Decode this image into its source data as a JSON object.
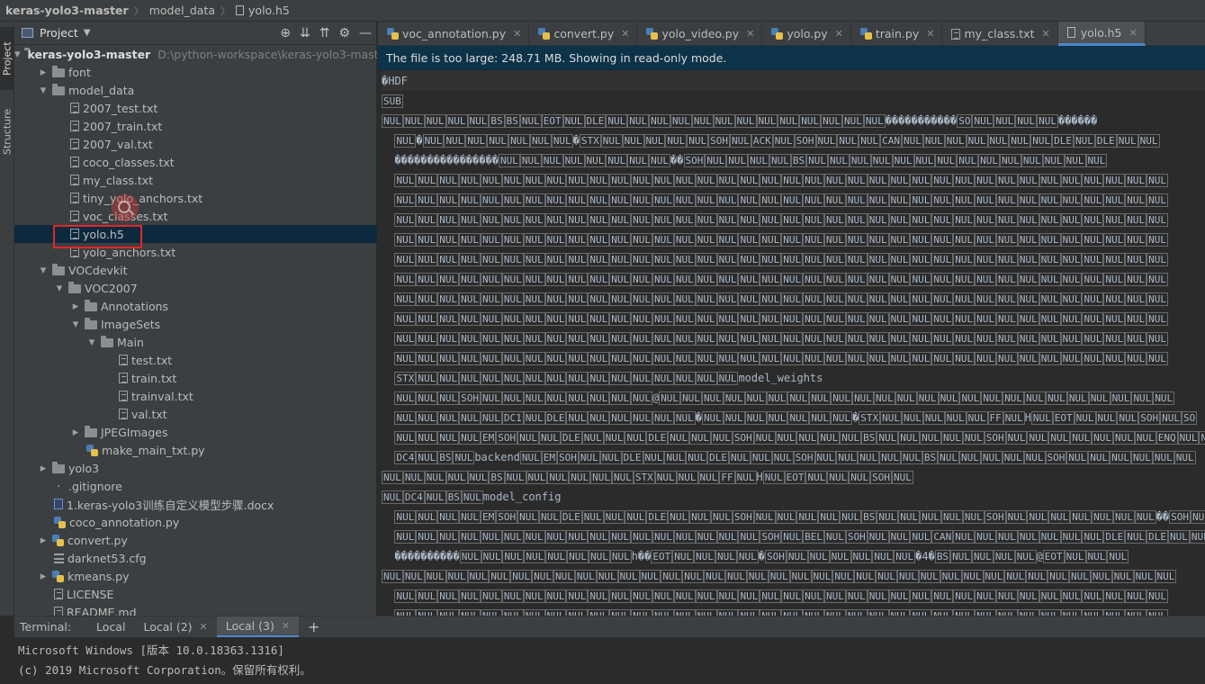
{
  "breadcrumb": [
    "keras-yolo3-master",
    "model_data",
    "yolo.h5"
  ],
  "side_strip": {
    "project": "Project",
    "structure": "Structure"
  },
  "project_panel": {
    "title": "Project"
  },
  "tree": [
    {
      "label": "keras-yolo3-master",
      "path": "D:\\python-workspace\\keras-yolo3-master",
      "type": "folder",
      "depth": 0,
      "expanded": true,
      "bold": true
    },
    {
      "label": "font",
      "type": "folder",
      "depth": 1,
      "expanded": false
    },
    {
      "label": "model_data",
      "type": "folder",
      "depth": 1,
      "expanded": true
    },
    {
      "label": "2007_test.txt",
      "type": "txt",
      "depth": 2
    },
    {
      "label": "2007_train.txt",
      "type": "txt",
      "depth": 2
    },
    {
      "label": "2007_val.txt",
      "type": "txt",
      "depth": 2
    },
    {
      "label": "coco_classes.txt",
      "type": "txt",
      "depth": 2
    },
    {
      "label": "my_class.txt",
      "type": "txt",
      "depth": 2
    },
    {
      "label": "tiny_yolo_anchors.txt",
      "type": "txt",
      "depth": 2
    },
    {
      "label": "voc_classes.txt",
      "type": "txt",
      "depth": 2
    },
    {
      "label": "yolo.h5",
      "type": "txt",
      "depth": 2,
      "selected": true
    },
    {
      "label": "yolo_anchors.txt",
      "type": "txt",
      "depth": 2
    },
    {
      "label": "VOCdevkit",
      "type": "folder",
      "depth": 1,
      "expanded": true
    },
    {
      "label": "VOC2007",
      "type": "folder",
      "depth": 2,
      "expanded": true
    },
    {
      "label": "Annotations",
      "type": "folder",
      "depth": 3,
      "expanded": false
    },
    {
      "label": "ImageSets",
      "type": "folder",
      "depth": 3,
      "expanded": true
    },
    {
      "label": "Main",
      "type": "folder",
      "depth": 4,
      "expanded": true
    },
    {
      "label": "test.txt",
      "type": "txt",
      "depth": 5
    },
    {
      "label": "train.txt",
      "type": "txt",
      "depth": 5
    },
    {
      "label": "trainval.txt",
      "type": "txt",
      "depth": 5
    },
    {
      "label": "val.txt",
      "type": "txt",
      "depth": 5
    },
    {
      "label": "JPEGImages",
      "type": "folder",
      "depth": 3,
      "expanded": false
    },
    {
      "label": "make_main_txt.py",
      "type": "py",
      "depth": 3
    },
    {
      "label": "yolo3",
      "type": "folder",
      "depth": 1,
      "expanded": false
    },
    {
      "label": ".gitignore",
      "type": "git",
      "depth": 1
    },
    {
      "label": "1.keras-yolo3训练自定义模型步骤.docx",
      "type": "doc",
      "depth": 1
    },
    {
      "label": "coco_annotation.py",
      "type": "py",
      "depth": 1
    },
    {
      "label": "convert.py",
      "type": "py",
      "depth": 1,
      "expanded": false,
      "arrow": true
    },
    {
      "label": "darknet53.cfg",
      "type": "cfg",
      "depth": 1
    },
    {
      "label": "kmeans.py",
      "type": "py",
      "depth": 1,
      "expanded": false,
      "arrow": true
    },
    {
      "label": "LICENSE",
      "type": "txt",
      "depth": 1
    },
    {
      "label": "README.md",
      "type": "txt",
      "depth": 1
    }
  ],
  "tabs": [
    {
      "label": "voc_annotation.py",
      "type": "py"
    },
    {
      "label": "convert.py",
      "type": "py"
    },
    {
      "label": "yolo_video.py",
      "type": "py"
    },
    {
      "label": "yolo.py",
      "type": "py"
    },
    {
      "label": "train.py",
      "type": "py"
    },
    {
      "label": "my_class.txt",
      "type": "txt"
    },
    {
      "label": "yolo.h5",
      "type": "h5",
      "active": true
    }
  ],
  "info_bar": "The file is too large: 248.71 MB. Showing in read-only mode.",
  "editor_lines": [
    "�HDF",
    "[SUB]",
    "[NUL][NUL][NUL][NUL][NUL][BS][BS][NUL][EOT][NUL][DLE][NUL][NUL][NUL][NUL][NUL][NUL][NUL][NUL][NUL][NUL][NUL][NUL][NUL]�����������[SO][NUL][NUL][NUL][NUL]������",
    "  [NUL]�[NUL][NUL][NUL][NUL][NUL][NUL][NUL]�[STX][NUL][NUL][NUL][NUL][NUL][SOH][NUL][ACK][NUL][SOH][NUL][NUL][NUL][CAN][NUL][NUL][NUL][NUL][NUL][NUL][NUL][DLE][NUL][DLE][NUL][NUL]",
    "  ����������������[NUL][NUL][NUL][NUL][NUL][NUL][NUL][NUL]��[SOH][NUL][NUL][NUL][NUL][BS][NUL][NUL][NUL][NUL][NUL][NUL][NUL][NUL][NUL][NUL][NUL][NUL][NUL][NUL]",
    "  [NUL][NUL][NUL][NUL][NUL][NUL][NUL][NUL][NUL][NUL][NUL][NUL][NUL][NUL][NUL][NUL][NUL][NUL][NUL][NUL][NUL][NUL][NUL][NUL][NUL][NUL][NUL][NUL][NUL][NUL][NUL][NUL][NUL][NUL][NUL][NUL]",
    "  [NUL][NUL][NUL][NUL][NUL][NUL][NUL][NUL][NUL][NUL][NUL][NUL][NUL][NUL][NUL][NUL][NUL][NUL][NUL][NUL][NUL][NUL][NUL][NUL][NUL][NUL][NUL][NUL][NUL][NUL][NUL][NUL][NUL][NUL][NUL][NUL]",
    "  [NUL][NUL][NUL][NUL][NUL][NUL][NUL][NUL][NUL][NUL][NUL][NUL][NUL][NUL][NUL][NUL][NUL][NUL][NUL][NUL][NUL][NUL][NUL][NUL][NUL][NUL][NUL][NUL][NUL][NUL][NUL][NUL][NUL][NUL][NUL][NUL]",
    "  [NUL][NUL][NUL][NUL][NUL][NUL][NUL][NUL][NUL][NUL][NUL][NUL][NUL][NUL][NUL][NUL][NUL][NUL][NUL][NUL][NUL][NUL][NUL][NUL][NUL][NUL][NUL][NUL][NUL][NUL][NUL][NUL][NUL][NUL][NUL][NUL]",
    "  [NUL][NUL][NUL][NUL][NUL][NUL][NUL][NUL][NUL][NUL][NUL][NUL][NUL][NUL][NUL][NUL][NUL][NUL][NUL][NUL][NUL][NUL][NUL][NUL][NUL][NUL][NUL][NUL][NUL][NUL][NUL][NUL][NUL][NUL][NUL][NUL]",
    "  [NUL][NUL][NUL][NUL][NUL][NUL][NUL][NUL][NUL][NUL][NUL][NUL][NUL][NUL][NUL][NUL][NUL][NUL][NUL][NUL][NUL][NUL][NUL][NUL][NUL][NUL][NUL][NUL][NUL][NUL][NUL][NUL][NUL][NUL][NUL][NUL]",
    "  [NUL][NUL][NUL][NUL][NUL][NUL][NUL][NUL][NUL][NUL][NUL][NUL][NUL][NUL][NUL][NUL][NUL][NUL][NUL][NUL][NUL][NUL][NUL][NUL][NUL][NUL][NUL][NUL][NUL][NUL][NUL][NUL][NUL][NUL][NUL][NUL]",
    "  [NUL][NUL][NUL][NUL][NUL][NUL][NUL][NUL][NUL][NUL][NUL][NUL][NUL][NUL][NUL][NUL][NUL][NUL][NUL][NUL][NUL][NUL][NUL][NUL][NUL][NUL][NUL][NUL][NUL][NUL][NUL][NUL][NUL][NUL][NUL][NUL]",
    "  [NUL][NUL][NUL][NUL][NUL][NUL][NUL][NUL][NUL][NUL][NUL][NUL][NUL][NUL][NUL][NUL][NUL][NUL][NUL][NUL][NUL][NUL][NUL][NUL][NUL][NUL][NUL][NUL][NUL][NUL][NUL][NUL][NUL][NUL][NUL][NUL]",
    "  [NUL][NUL][NUL][NUL][NUL][NUL][NUL][NUL][NUL][NUL][NUL][NUL][NUL][NUL][NUL][NUL][NUL][NUL][NUL][NUL][NUL][NUL][NUL][NUL][NUL][NUL][NUL][NUL][NUL][NUL][NUL][NUL][NUL][NUL][NUL][NUL]",
    "  [STX][NUL][NUL][NUL][NUL][NUL][NUL][NUL][NUL][NUL][NUL][NUL][NUL][NUL][NUL][NUL]model_weights",
    "  [NUL][NUL][NUL][SOH][NUL][NUL][NUL][NUL][NUL][NUL][NUL][NUL]@[NUL][NUL][NUL][NUL][NUL][NUL][NUL][NUL][NUL][NUL][NUL][NUL][NUL][NUL][NUL][NUL][NUL][NUL][NUL][NUL][NUL][NUL][NUL][NUL]",
    "  [NUL][NUL][NUL][NUL][NUL][DC1][NUL][DLE][NUL][NUL][NUL][NUL][NUL][NUL]�[NUL][NUL][NUL][NUL][NUL][NUL][NUL]�[STX][NUL][NUL][NUL][NUL][NUL][FF][NUL]H[NUL][EOT][NUL][NUL][NUL][SOH][NUL][SO]",
    "  [NUL][NUL][NUL][NUL][EM][SOH][NUL][NUL][DLE][NUL][NUL][NUL][DLE][NUL][NUL][NUL][SOH][NUL][NUL][NUL][NUL][NUL][BS][NUL][NUL][NUL][NUL][NUL][SOH][NUL][NUL][NUL][NUL][NUL][NUL][NUL][ENQ][NUL][NUL]",
    "  [DC4][NUL][BS][NUL]backend[NUL][EM][SOH][NUL][NUL][DLE][NUL][NUL][NUL][DLE][NUL][NUL][NUL][SOH][NUL][NUL][NUL][NUL][NUL][BS][NUL][NUL][NUL][NUL][NUL][SOH][NUL][NUL][NUL][NUL][NUL][NUL]",
    "[NUL][NUL][NUL][NUL][NUL][BS][NUL][NUL][NUL][NUL][NUL][NUL][STX][NUL][NUL][NUL][FF][NUL]H[NUL][EOT][NUL][NUL][NUL][SOH][NUL]",
    "[NUL][DC4][NUL][BS][NUL]model_config",
    "  [NUL][NUL][NUL][NUL][EM][SOH][NUL][NUL][DLE][NUL][NUL][NUL][DLE][NUL][NUL][NUL][SOH][NUL][NUL][NUL][NUL][NUL][BS][NUL][NUL][NUL][NUL][NUL][SOH][NUL][NUL][NUL][NUL][NUL][NUL][NUL]��[SOH][NUL]",
    "  [NUL][NUL][NUL][NUL][NUL][NUL][NUL][NUL][NUL][NUL][NUL][NUL][NUL][NUL][NUL][NUL][NUL][SOH][NUL][BEL][NUL][SOH][NUL][NUL][NUL][CAN][NUL][NUL][NUL][NUL][NUL][NUL][NUL][DLE][NUL][DLE][NUL][NUL]",
    "  ����������[NUL][NUL][NUL][NUL][NUL][NUL][NUL][NUL]h��[EOT][NUL][NUL][NUL][NUL]�[SOH][NUL][NUL][NUL][NUL][NUL][NUL]�4�[BS][NUL][NUL][NUL][NUL]@[EOT][NUL][NUL][NUL]",
    "[NUL][NUL][NUL][NUL][NUL][NUL][NUL][NUL][NUL][NUL][NUL][NUL][NUL][NUL][NUL][NUL][NUL][NUL][NUL][NUL][NUL][NUL][NUL][NUL][NUL][NUL][NUL][NUL][NUL][NUL][NUL][NUL][NUL][NUL][NUL][NUL][NUL]",
    "  [NUL][NUL][NUL][NUL][NUL][NUL][NUL][NUL][NUL][NUL][NUL][NUL][NUL][NUL][NUL][NUL][NUL][NUL][NUL][NUL][NUL][NUL][NUL][NUL][NUL][NUL][NUL][NUL][NUL][NUL][NUL][NUL][NUL][NUL][NUL][NUL]",
    "  [NUL][NUL][NUL][NUL][NUL][NUL][NUL][NUL][NUL][NUL][NUL][NUL][NUL][NUL][NUL][NUL][NUL][NUL][NUL][NUL][NUL][NUL][NUL][NUL][NUL][NUL][NUL][NUL][NUL][NUL][NUL][NUL][NUL][NUL][NUL][NUL]",
    "  [NUL][NUL][NUL][NUL][NUL][NUL][NUL][NUL][NUL][NUL][NUL][NUL][NUL][NUL][NUL][NUL][NUL][NUL][NUL][NUL][NUL][NUL][NUL][NUL][NUL][NUL][NUL][NUL][NUL][NUL][NUL][NUL][NUL][NUL][NUL][NUL]"
  ],
  "terminal": {
    "label": "Terminal:",
    "tabs": [
      "Local",
      "Local (2)",
      "Local (3)"
    ],
    "active_tab": 2,
    "lines": [
      "Microsoft Windows [版本 10.0.18363.1316]",
      "(c) 2019 Microsoft Corporation。保留所有权利。"
    ]
  }
}
